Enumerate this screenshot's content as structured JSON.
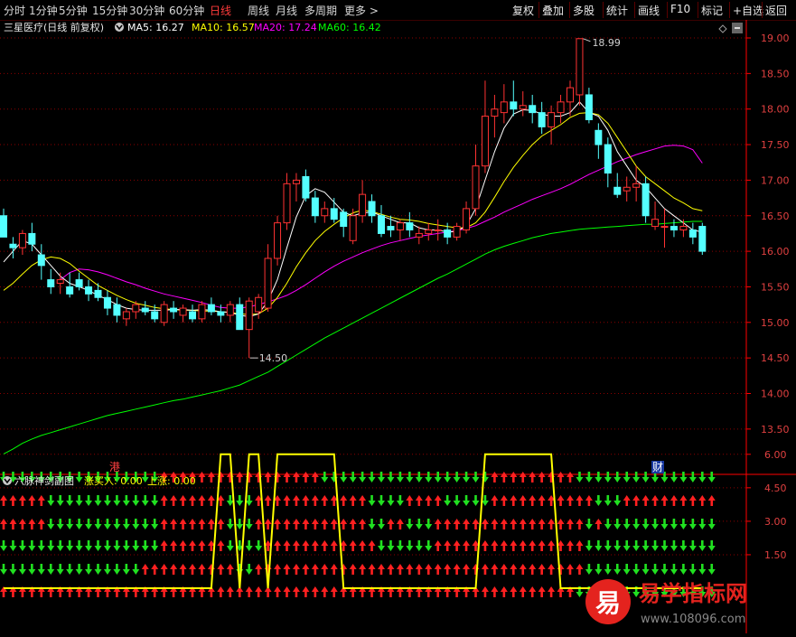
{
  "toolbar": {
    "left": [
      "分时",
      "1分钟",
      "5分钟",
      "15分钟",
      "30分钟",
      "60分钟",
      "日线",
      "周线",
      "月线",
      "多周期",
      "更多 >"
    ],
    "active": "日线",
    "right": [
      "复权",
      "叠加",
      "多股",
      "统计",
      "画线",
      "F10",
      "标记",
      "+自选",
      "返回"
    ]
  },
  "legend": {
    "stock": "三星医疗(日线 前复权)",
    "ma5": "MA5: 16.27",
    "ma10": "MA10: 16.57",
    "ma20": "MA20: 17.24",
    "ma60": "MA60: 16.42"
  },
  "colors": {
    "up": "#ff3232",
    "down": "#54ffff",
    "ma5": "#ffffff",
    "ma10": "#ffff00",
    "ma20": "#ff00ff",
    "ma60": "#00ff00",
    "grid": "#8b0000",
    "axis": "#ff0000"
  },
  "markers": {
    "gang": "港",
    "cai": "财"
  },
  "annotations": {
    "high": "18.99",
    "low": "14.50"
  },
  "sub_legend": {
    "title": "六脉神剑副图",
    "buy": "涨买入: 0.00",
    "rise": "上涨: 0.00"
  },
  "watermark": {
    "badge": "易",
    "name": "易学指标网",
    "url": "www.108096.com"
  },
  "chart_data": [
    {
      "type": "candlestick",
      "title": "三星医疗(日线 前复权)",
      "y_ticks": [
        "19.00",
        "18.50",
        "18.00",
        "17.50",
        "17.00",
        "16.50",
        "16.00",
        "15.50",
        "15.00",
        "14.50",
        "14.00",
        "13.50"
      ],
      "ylim": [
        13.2,
        19.25
      ],
      "candles": [
        [
          16.5,
          16.6,
          16.3,
          16.2
        ],
        [
          16.1,
          16.2,
          15.9,
          16.05
        ],
        [
          16.05,
          16.3,
          15.95,
          16.25
        ],
        [
          16.25,
          16.4,
          16.0,
          16.1
        ],
        [
          15.95,
          16.1,
          15.6,
          15.8
        ],
        [
          15.6,
          15.75,
          15.4,
          15.5
        ],
        [
          15.55,
          15.7,
          15.4,
          15.6
        ],
        [
          15.5,
          15.7,
          15.35,
          15.4
        ],
        [
          15.6,
          15.7,
          15.45,
          15.5
        ],
        [
          15.5,
          15.6,
          15.3,
          15.4
        ],
        [
          15.45,
          15.55,
          15.3,
          15.35
        ],
        [
          15.35,
          15.45,
          15.1,
          15.2
        ],
        [
          15.25,
          15.35,
          15.0,
          15.1
        ],
        [
          15.05,
          15.2,
          14.95,
          15.15
        ],
        [
          15.15,
          15.3,
          15.05,
          15.25
        ],
        [
          15.2,
          15.3,
          15.1,
          15.15
        ],
        [
          15.15,
          15.25,
          15.0,
          15.05
        ],
        [
          15.0,
          15.3,
          14.95,
          15.25
        ],
        [
          15.2,
          15.3,
          15.05,
          15.15
        ],
        [
          15.1,
          15.25,
          15.0,
          15.2
        ],
        [
          15.15,
          15.25,
          15.0,
          15.05
        ],
        [
          15.05,
          15.3,
          15.0,
          15.25
        ],
        [
          15.25,
          15.35,
          15.1,
          15.15
        ],
        [
          15.15,
          15.25,
          15.0,
          15.1
        ],
        [
          15.1,
          15.3,
          15.0,
          15.25
        ],
        [
          15.25,
          15.35,
          15.05,
          14.9
        ],
        [
          14.9,
          15.35,
          14.5,
          15.3
        ],
        [
          15.15,
          15.4,
          15.05,
          15.35
        ],
        [
          15.2,
          16.1,
          15.15,
          15.9
        ],
        [
          15.9,
          16.5,
          15.8,
          16.4
        ],
        [
          16.4,
          17.1,
          16.3,
          16.95
        ],
        [
          16.95,
          17.1,
          16.7,
          17.0
        ],
        [
          17.05,
          17.15,
          16.7,
          16.75
        ],
        [
          16.75,
          16.85,
          16.4,
          16.5
        ],
        [
          16.5,
          16.7,
          16.4,
          16.6
        ],
        [
          16.6,
          16.75,
          16.4,
          16.45
        ],
        [
          16.55,
          16.6,
          16.2,
          16.35
        ],
        [
          16.15,
          16.6,
          16.1,
          16.5
        ],
        [
          16.5,
          17.0,
          16.4,
          16.8
        ],
        [
          16.7,
          16.8,
          16.4,
          16.5
        ],
        [
          16.5,
          16.65,
          16.2,
          16.25
        ],
        [
          16.35,
          16.5,
          16.2,
          16.3
        ],
        [
          16.3,
          16.45,
          16.15,
          16.4
        ],
        [
          16.4,
          16.55,
          16.2,
          16.3
        ],
        [
          16.2,
          16.35,
          16.1,
          16.25
        ],
        [
          16.25,
          16.4,
          16.15,
          16.3
        ],
        [
          16.3,
          16.45,
          16.15,
          16.3
        ],
        [
          16.3,
          16.4,
          16.1,
          16.2
        ],
        [
          16.2,
          16.4,
          16.15,
          16.35
        ],
        [
          16.3,
          16.7,
          16.25,
          16.6
        ],
        [
          16.6,
          17.5,
          16.5,
          17.2
        ],
        [
          17.2,
          18.4,
          17.1,
          17.9
        ],
        [
          17.9,
          18.2,
          17.6,
          18.0
        ],
        [
          17.95,
          18.35,
          17.8,
          18.1
        ],
        [
          18.1,
          18.4,
          17.9,
          18.0
        ],
        [
          18.0,
          18.25,
          17.9,
          18.05
        ],
        [
          18.05,
          18.2,
          17.8,
          17.95
        ],
        [
          17.95,
          18.1,
          17.65,
          17.75
        ],
        [
          17.75,
          18.05,
          17.5,
          17.95
        ],
        [
          17.95,
          18.2,
          17.8,
          18.1
        ],
        [
          18.1,
          18.4,
          17.9,
          18.3
        ],
        [
          18.2,
          18.99,
          18.05,
          18.99
        ],
        [
          18.2,
          18.3,
          17.8,
          17.85
        ],
        [
          17.7,
          17.8,
          17.3,
          17.5
        ],
        [
          17.5,
          17.6,
          16.9,
          17.1
        ],
        [
          16.9,
          17.1,
          16.75,
          16.8
        ],
        [
          16.85,
          17.05,
          16.7,
          16.9
        ],
        [
          16.9,
          17.2,
          16.7,
          16.95
        ],
        [
          16.95,
          17.05,
          16.4,
          16.5
        ],
        [
          16.35,
          16.7,
          16.3,
          16.45
        ],
        [
          16.35,
          16.6,
          16.05,
          16.35
        ],
        [
          16.35,
          16.45,
          16.2,
          16.3
        ],
        [
          16.3,
          16.45,
          16.2,
          16.35
        ],
        [
          16.3,
          16.4,
          16.1,
          16.2
        ],
        [
          16.35,
          16.4,
          15.95,
          16.0
        ]
      ],
      "ma5": [
        15.85,
        16.0,
        16.15,
        16.1,
        15.95,
        15.8,
        15.65,
        15.55,
        15.5,
        15.45,
        15.38,
        15.32,
        15.25,
        15.2,
        15.18,
        15.17,
        15.17,
        15.17,
        15.18,
        15.18,
        15.17,
        15.18,
        15.17,
        15.15,
        15.14,
        15.1,
        15.08,
        15.12,
        15.3,
        15.6,
        16.05,
        16.48,
        16.78,
        16.88,
        16.83,
        16.69,
        16.55,
        16.5,
        16.54,
        16.55,
        16.5,
        16.45,
        16.4,
        16.4,
        16.33,
        16.3,
        16.3,
        16.27,
        16.28,
        16.36,
        16.6,
        17.0,
        17.4,
        17.73,
        17.93,
        17.99,
        17.98,
        17.93,
        17.9,
        17.9,
        17.95,
        18.1,
        17.95,
        17.9,
        17.7,
        17.4,
        17.2,
        17.0,
        16.9,
        16.75,
        16.6,
        16.5,
        16.4,
        16.3,
        16.27
      ],
      "ma10": [
        15.45,
        15.55,
        15.68,
        15.8,
        15.88,
        15.92,
        15.9,
        15.83,
        15.72,
        15.62,
        15.52,
        15.45,
        15.38,
        15.32,
        15.27,
        15.24,
        15.21,
        15.19,
        15.18,
        15.17,
        15.17,
        15.16,
        15.16,
        15.15,
        15.14,
        15.12,
        15.11,
        15.12,
        15.2,
        15.35,
        15.55,
        15.78,
        15.98,
        16.15,
        16.28,
        16.38,
        16.47,
        16.54,
        16.58,
        16.56,
        16.52,
        16.48,
        16.45,
        16.44,
        16.42,
        16.39,
        16.37,
        16.35,
        16.33,
        16.33,
        16.4,
        16.55,
        16.76,
        16.98,
        17.18,
        17.35,
        17.5,
        17.62,
        17.7,
        17.78,
        17.88,
        17.94,
        17.95,
        17.92,
        17.8,
        17.6,
        17.4,
        17.2,
        17.05,
        16.95,
        16.85,
        16.75,
        16.68,
        16.6,
        16.57
      ],
      "ma20": [
        null,
        null,
        null,
        null,
        null,
        null,
        15.6,
        15.7,
        15.75,
        15.74,
        15.71,
        15.67,
        15.62,
        15.57,
        15.53,
        15.48,
        15.44,
        15.4,
        15.37,
        15.34,
        15.31,
        15.28,
        15.24,
        15.21,
        15.2,
        15.2,
        15.22,
        15.25,
        15.29,
        15.33,
        15.38,
        15.45,
        15.53,
        15.62,
        15.71,
        15.79,
        15.86,
        15.92,
        15.98,
        16.03,
        16.08,
        16.12,
        16.15,
        16.18,
        16.21,
        16.23,
        16.25,
        16.27,
        16.29,
        16.32,
        16.36,
        16.42,
        16.48,
        16.55,
        16.61,
        16.67,
        16.73,
        16.78,
        16.83,
        16.88,
        16.94,
        17.01,
        17.08,
        17.14,
        17.2,
        17.26,
        17.31,
        17.36,
        17.4,
        17.44,
        17.48,
        17.49,
        17.48,
        17.43,
        17.24
      ],
      "ma60": [
        13.15,
        13.22,
        13.3,
        13.36,
        13.41,
        13.45,
        13.49,
        13.53,
        13.57,
        13.61,
        13.65,
        13.69,
        13.72,
        13.75,
        13.78,
        13.81,
        13.84,
        13.87,
        13.9,
        13.92,
        13.95,
        13.98,
        14.01,
        14.04,
        14.08,
        14.12,
        14.18,
        14.24,
        14.3,
        14.38,
        14.46,
        14.54,
        14.62,
        14.7,
        14.78,
        14.85,
        14.92,
        14.99,
        15.06,
        15.13,
        15.2,
        15.27,
        15.34,
        15.41,
        15.48,
        15.55,
        15.62,
        15.68,
        15.75,
        15.82,
        15.89,
        15.96,
        16.02,
        16.07,
        16.11,
        16.15,
        16.19,
        16.22,
        16.25,
        16.27,
        16.29,
        16.31,
        16.32,
        16.33,
        16.34,
        16.35,
        16.36,
        16.37,
        16.38,
        16.38,
        16.39,
        16.4,
        16.41,
        16.42,
        16.42
      ]
    },
    {
      "type": "indicator",
      "title": "六脉神剑副图",
      "y_ticks": [
        "6.00",
        "4.50",
        "3.00",
        "1.50"
      ],
      "ylim": [
        0,
        6.5
      ],
      "rows": [
        "DDDDDDDDDDDDDDDDDUUUUUUUUUUUUUUUUUDDDDDDDDDDDDDDDDDDUUUUUUUUUDDDDDDDDDDDDDDDDD",
        "UUUUUDDDDDDDDDDDDUUUUUUUDDDUUUUUUUUUUUUDDDDUUUUDDDDDUUUUUUUUUUUDDDUUUUUUUUUUDD",
        "UUUUUDDDDDDDDDDDDUUUUUUUDDDUUUUUUUUUUUUDDUUDDDUUUUUUUUUUUUUUUUDUDDDDDDDDDDDDDD",
        "DDDDDDDDDDDDDDDDDUUUUUUUDDDDUUUUUUUUUUUUDDDDDDUUUUUUUUUUUUUUUUDDDDDDDDDDDDDDDD",
        "DDDDDDDDDDDDDDDUUUUUUUUUUDDUUUUUUUUUUUUUUUUUUUUUUUUUUUUUUUUUUUDDDDDDDDDDDDDDDD",
        "UUUUUUUUUUUUUUUUUUUUUUUUUUUUUUUUUUUUUUUUUUUUUUUUUUUUUUUUUUUUUDDDDDDDDDDDDDDDD"
      ],
      "line": [
        0,
        0,
        0,
        0,
        0,
        0,
        0,
        0,
        0,
        0,
        0,
        0,
        0,
        0,
        0,
        0,
        0,
        0,
        0,
        0,
        0,
        0,
        0,
        6,
        6,
        0,
        6,
        6,
        0,
        6,
        6,
        6,
        6,
        6,
        6,
        6,
        0,
        0,
        0,
        0,
        0,
        0,
        0,
        0,
        0,
        0,
        0,
        0,
        0,
        0,
        0,
        6,
        6,
        6,
        6,
        6,
        6,
        6,
        6,
        0,
        0,
        0,
        0,
        0,
        0,
        0,
        0,
        0,
        0,
        0,
        0,
        0,
        0,
        0,
        0
      ]
    }
  ]
}
